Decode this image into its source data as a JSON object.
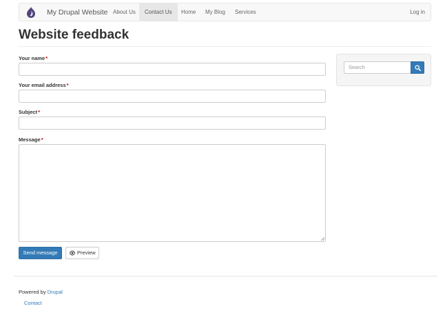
{
  "navbar": {
    "site_name": "My Drupal Website",
    "items": [
      {
        "label": "About Us"
      },
      {
        "label": "Contact Us"
      },
      {
        "label": "Home"
      },
      {
        "label": "My Blog"
      },
      {
        "label": "Services"
      }
    ],
    "active_item": "Contact Us",
    "login_label": "Log in",
    "logo_icon": "drupal-drop-icon",
    "logo_color": "#53457c"
  },
  "page": {
    "title": "Website feedback"
  },
  "form": {
    "required_marker": "*",
    "fields": [
      {
        "label": "Your name",
        "value": ""
      },
      {
        "label": "Your email address",
        "value": ""
      },
      {
        "label": "Subject",
        "value": ""
      },
      {
        "label": "Message",
        "value": ""
      }
    ],
    "send_label": "Send message",
    "preview_label": "Preview",
    "preview_icon": "eye-icon"
  },
  "sidebar": {
    "search_placeholder": "Search",
    "search_icon": "search-icon"
  },
  "footer": {
    "powered_prefix": "Powered by",
    "powered_link": "Drupal",
    "contact_link": "Contact"
  },
  "colors": {
    "primary": "#337ab7",
    "required": "#cc0000",
    "navbar_bg": "#f8f8f8",
    "nav_active_bg": "#e7e7e7"
  }
}
